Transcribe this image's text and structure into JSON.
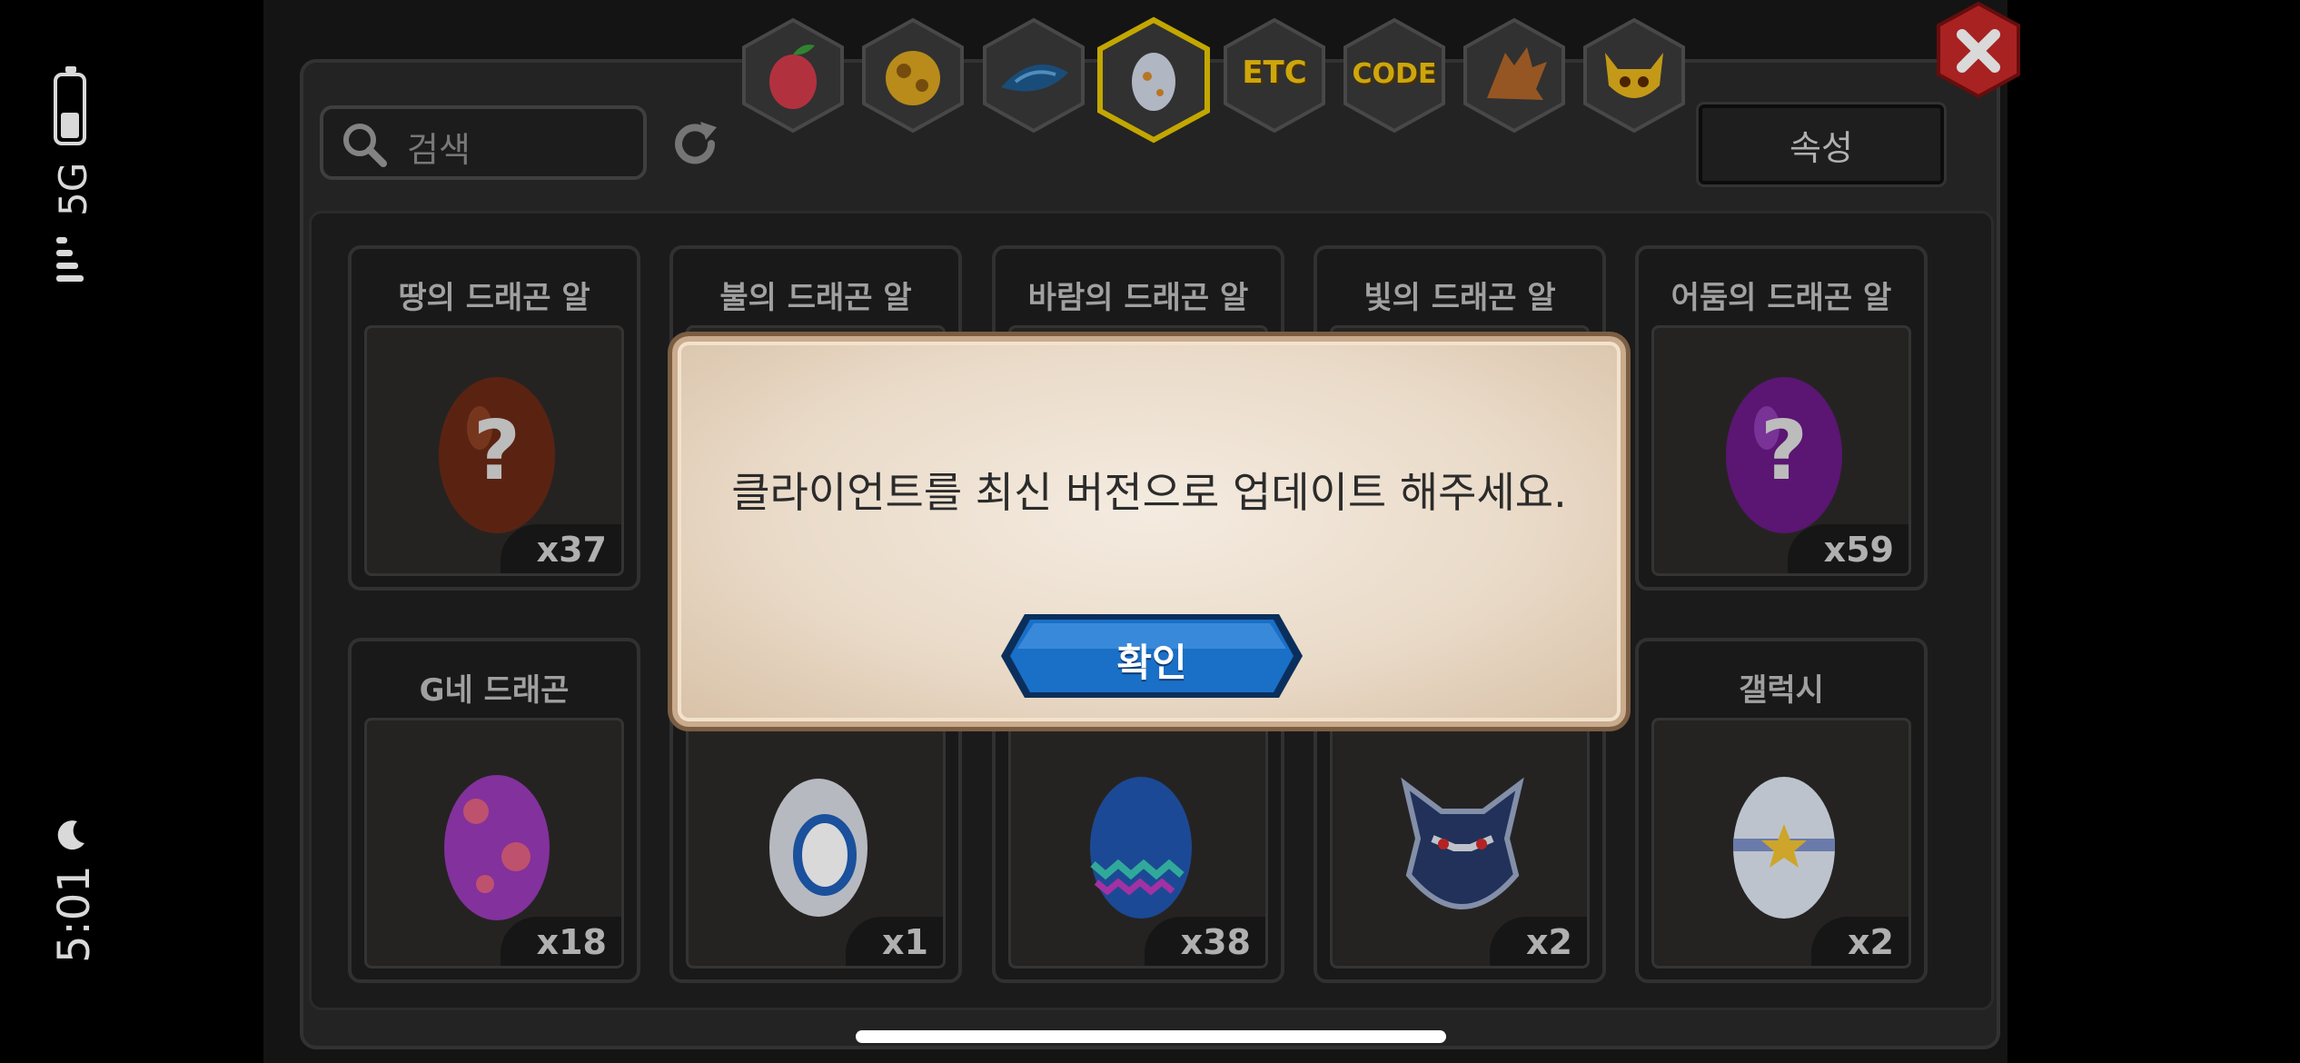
{
  "status_bar": {
    "time": "5:01",
    "network": "5G"
  },
  "search": {
    "placeholder": "검색"
  },
  "attribute_button": {
    "label": "속성"
  },
  "tabs": [
    {
      "name": "fruit",
      "label": ""
    },
    {
      "name": "gold",
      "label": ""
    },
    {
      "name": "material",
      "label": ""
    },
    {
      "name": "egg",
      "label": "",
      "selected": true
    },
    {
      "name": "etc",
      "label": "ETC"
    },
    {
      "name": "code",
      "label": "CODE"
    },
    {
      "name": "dragon",
      "label": ""
    },
    {
      "name": "mask",
      "label": ""
    }
  ],
  "cards": [
    {
      "title": "땅의 드래곤 알",
      "qty": "x37",
      "egg": "earth"
    },
    {
      "title": "불의 드래곤 알",
      "qty": "",
      "egg": "fire"
    },
    {
      "title": "바람의 드래곤 알",
      "qty": "",
      "egg": "wind"
    },
    {
      "title": "빛의 드래곤 알",
      "qty": "",
      "egg": "light"
    },
    {
      "title": "어둠의 드래곤 알",
      "qty": "x59",
      "egg": "dark"
    },
    {
      "title": "G네 드래곤",
      "qty": "x18",
      "egg": "pink-spotted"
    },
    {
      "title": "",
      "qty": "x1",
      "egg": "white-ring"
    },
    {
      "title": "",
      "qty": "x38",
      "egg": "blue-pattern"
    },
    {
      "title": "",
      "qty": "x2",
      "egg": "dragon-mask"
    },
    {
      "title": "갤럭시",
      "qty": "x2",
      "egg": "galaxy"
    }
  ],
  "dialog": {
    "message": "클라이언트를 최신 버전으로 업데이트 해주세요.",
    "confirm_label": "확인"
  },
  "colors": {
    "dialog_bg": "#efe3d5",
    "confirm_blue": "#1a6fc6",
    "tab_selected": "#e5c500",
    "close_red": "#d32f2f"
  }
}
